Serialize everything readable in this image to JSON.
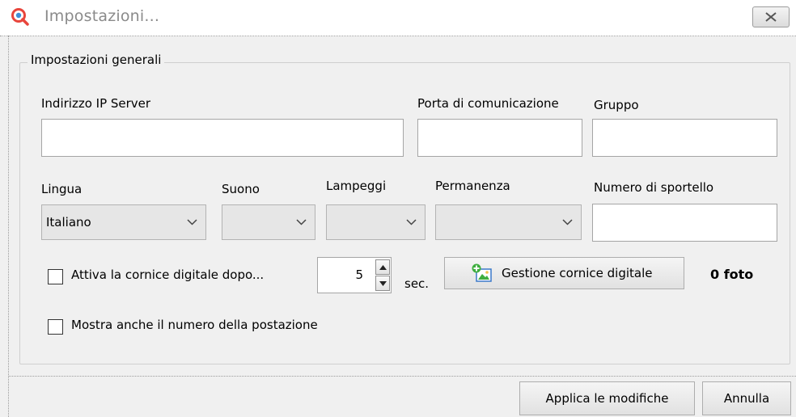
{
  "window": {
    "title": "Impostazioni...",
    "icons": {
      "app": "app-magnifier-icon",
      "close": "close-icon"
    }
  },
  "group": {
    "title": "Impostazioni generali"
  },
  "fields": {
    "server_ip": {
      "label": "Indirizzo IP Server",
      "value": ""
    },
    "port": {
      "label": "Porta di comunicazione",
      "value": ""
    },
    "group": {
      "label": "Gruppo",
      "value": ""
    },
    "language": {
      "label": "Lingua",
      "value": "Italiano"
    },
    "sound": {
      "label": "Suono",
      "value": ""
    },
    "flash": {
      "label": "Lampeggi",
      "value": ""
    },
    "duration": {
      "label": "Permanenza",
      "value": ""
    },
    "counter_number": {
      "label": "Numero di sportello",
      "value": ""
    }
  },
  "digital_frame": {
    "checkbox_label": "Attiva la cornice digitale dopo...",
    "checked": false,
    "delay_value": "5",
    "unit": "sec.",
    "manage_button": "Gestione cornice digitale",
    "photo_count": "0 foto"
  },
  "show_station": {
    "checkbox_label": "Mostra anche il numero della postazione",
    "checked": false
  },
  "footer": {
    "apply_button": "Applica le modifiche",
    "cancel_button": "Annulla"
  },
  "colors": {
    "app_icon_ring": "#e8453c",
    "app_icon_center": "#3f8fd8",
    "frame_icon_green": "#3fae3f",
    "frame_icon_blue": "#3a79c9"
  }
}
